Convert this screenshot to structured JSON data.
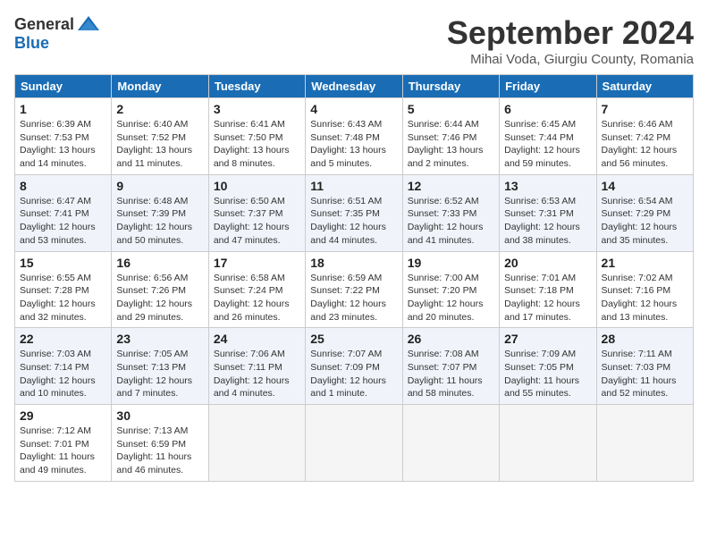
{
  "header": {
    "logo_general": "General",
    "logo_blue": "Blue",
    "month_title": "September 2024",
    "location": "Mihai Voda, Giurgiu County, Romania"
  },
  "weekdays": [
    "Sunday",
    "Monday",
    "Tuesday",
    "Wednesday",
    "Thursday",
    "Friday",
    "Saturday"
  ],
  "weeks": [
    [
      {
        "day": "1",
        "details": "Sunrise: 6:39 AM\nSunset: 7:53 PM\nDaylight: 13 hours\nand 14 minutes."
      },
      {
        "day": "2",
        "details": "Sunrise: 6:40 AM\nSunset: 7:52 PM\nDaylight: 13 hours\nand 11 minutes."
      },
      {
        "day": "3",
        "details": "Sunrise: 6:41 AM\nSunset: 7:50 PM\nDaylight: 13 hours\nand 8 minutes."
      },
      {
        "day": "4",
        "details": "Sunrise: 6:43 AM\nSunset: 7:48 PM\nDaylight: 13 hours\nand 5 minutes."
      },
      {
        "day": "5",
        "details": "Sunrise: 6:44 AM\nSunset: 7:46 PM\nDaylight: 13 hours\nand 2 minutes."
      },
      {
        "day": "6",
        "details": "Sunrise: 6:45 AM\nSunset: 7:44 PM\nDaylight: 12 hours\nand 59 minutes."
      },
      {
        "day": "7",
        "details": "Sunrise: 6:46 AM\nSunset: 7:42 PM\nDaylight: 12 hours\nand 56 minutes."
      }
    ],
    [
      {
        "day": "8",
        "details": "Sunrise: 6:47 AM\nSunset: 7:41 PM\nDaylight: 12 hours\nand 53 minutes."
      },
      {
        "day": "9",
        "details": "Sunrise: 6:48 AM\nSunset: 7:39 PM\nDaylight: 12 hours\nand 50 minutes."
      },
      {
        "day": "10",
        "details": "Sunrise: 6:50 AM\nSunset: 7:37 PM\nDaylight: 12 hours\nand 47 minutes."
      },
      {
        "day": "11",
        "details": "Sunrise: 6:51 AM\nSunset: 7:35 PM\nDaylight: 12 hours\nand 44 minutes."
      },
      {
        "day": "12",
        "details": "Sunrise: 6:52 AM\nSunset: 7:33 PM\nDaylight: 12 hours\nand 41 minutes."
      },
      {
        "day": "13",
        "details": "Sunrise: 6:53 AM\nSunset: 7:31 PM\nDaylight: 12 hours\nand 38 minutes."
      },
      {
        "day": "14",
        "details": "Sunrise: 6:54 AM\nSunset: 7:29 PM\nDaylight: 12 hours\nand 35 minutes."
      }
    ],
    [
      {
        "day": "15",
        "details": "Sunrise: 6:55 AM\nSunset: 7:28 PM\nDaylight: 12 hours\nand 32 minutes."
      },
      {
        "day": "16",
        "details": "Sunrise: 6:56 AM\nSunset: 7:26 PM\nDaylight: 12 hours\nand 29 minutes."
      },
      {
        "day": "17",
        "details": "Sunrise: 6:58 AM\nSunset: 7:24 PM\nDaylight: 12 hours\nand 26 minutes."
      },
      {
        "day": "18",
        "details": "Sunrise: 6:59 AM\nSunset: 7:22 PM\nDaylight: 12 hours\nand 23 minutes."
      },
      {
        "day": "19",
        "details": "Sunrise: 7:00 AM\nSunset: 7:20 PM\nDaylight: 12 hours\nand 20 minutes."
      },
      {
        "day": "20",
        "details": "Sunrise: 7:01 AM\nSunset: 7:18 PM\nDaylight: 12 hours\nand 17 minutes."
      },
      {
        "day": "21",
        "details": "Sunrise: 7:02 AM\nSunset: 7:16 PM\nDaylight: 12 hours\nand 13 minutes."
      }
    ],
    [
      {
        "day": "22",
        "details": "Sunrise: 7:03 AM\nSunset: 7:14 PM\nDaylight: 12 hours\nand 10 minutes."
      },
      {
        "day": "23",
        "details": "Sunrise: 7:05 AM\nSunset: 7:13 PM\nDaylight: 12 hours\nand 7 minutes."
      },
      {
        "day": "24",
        "details": "Sunrise: 7:06 AM\nSunset: 7:11 PM\nDaylight: 12 hours\nand 4 minutes."
      },
      {
        "day": "25",
        "details": "Sunrise: 7:07 AM\nSunset: 7:09 PM\nDaylight: 12 hours\nand 1 minute."
      },
      {
        "day": "26",
        "details": "Sunrise: 7:08 AM\nSunset: 7:07 PM\nDaylight: 11 hours\nand 58 minutes."
      },
      {
        "day": "27",
        "details": "Sunrise: 7:09 AM\nSunset: 7:05 PM\nDaylight: 11 hours\nand 55 minutes."
      },
      {
        "day": "28",
        "details": "Sunrise: 7:11 AM\nSunset: 7:03 PM\nDaylight: 11 hours\nand 52 minutes."
      }
    ],
    [
      {
        "day": "29",
        "details": "Sunrise: 7:12 AM\nSunset: 7:01 PM\nDaylight: 11 hours\nand 49 minutes."
      },
      {
        "day": "30",
        "details": "Sunrise: 7:13 AM\nSunset: 6:59 PM\nDaylight: 11 hours\nand 46 minutes."
      },
      {
        "day": "",
        "details": ""
      },
      {
        "day": "",
        "details": ""
      },
      {
        "day": "",
        "details": ""
      },
      {
        "day": "",
        "details": ""
      },
      {
        "day": "",
        "details": ""
      }
    ]
  ]
}
